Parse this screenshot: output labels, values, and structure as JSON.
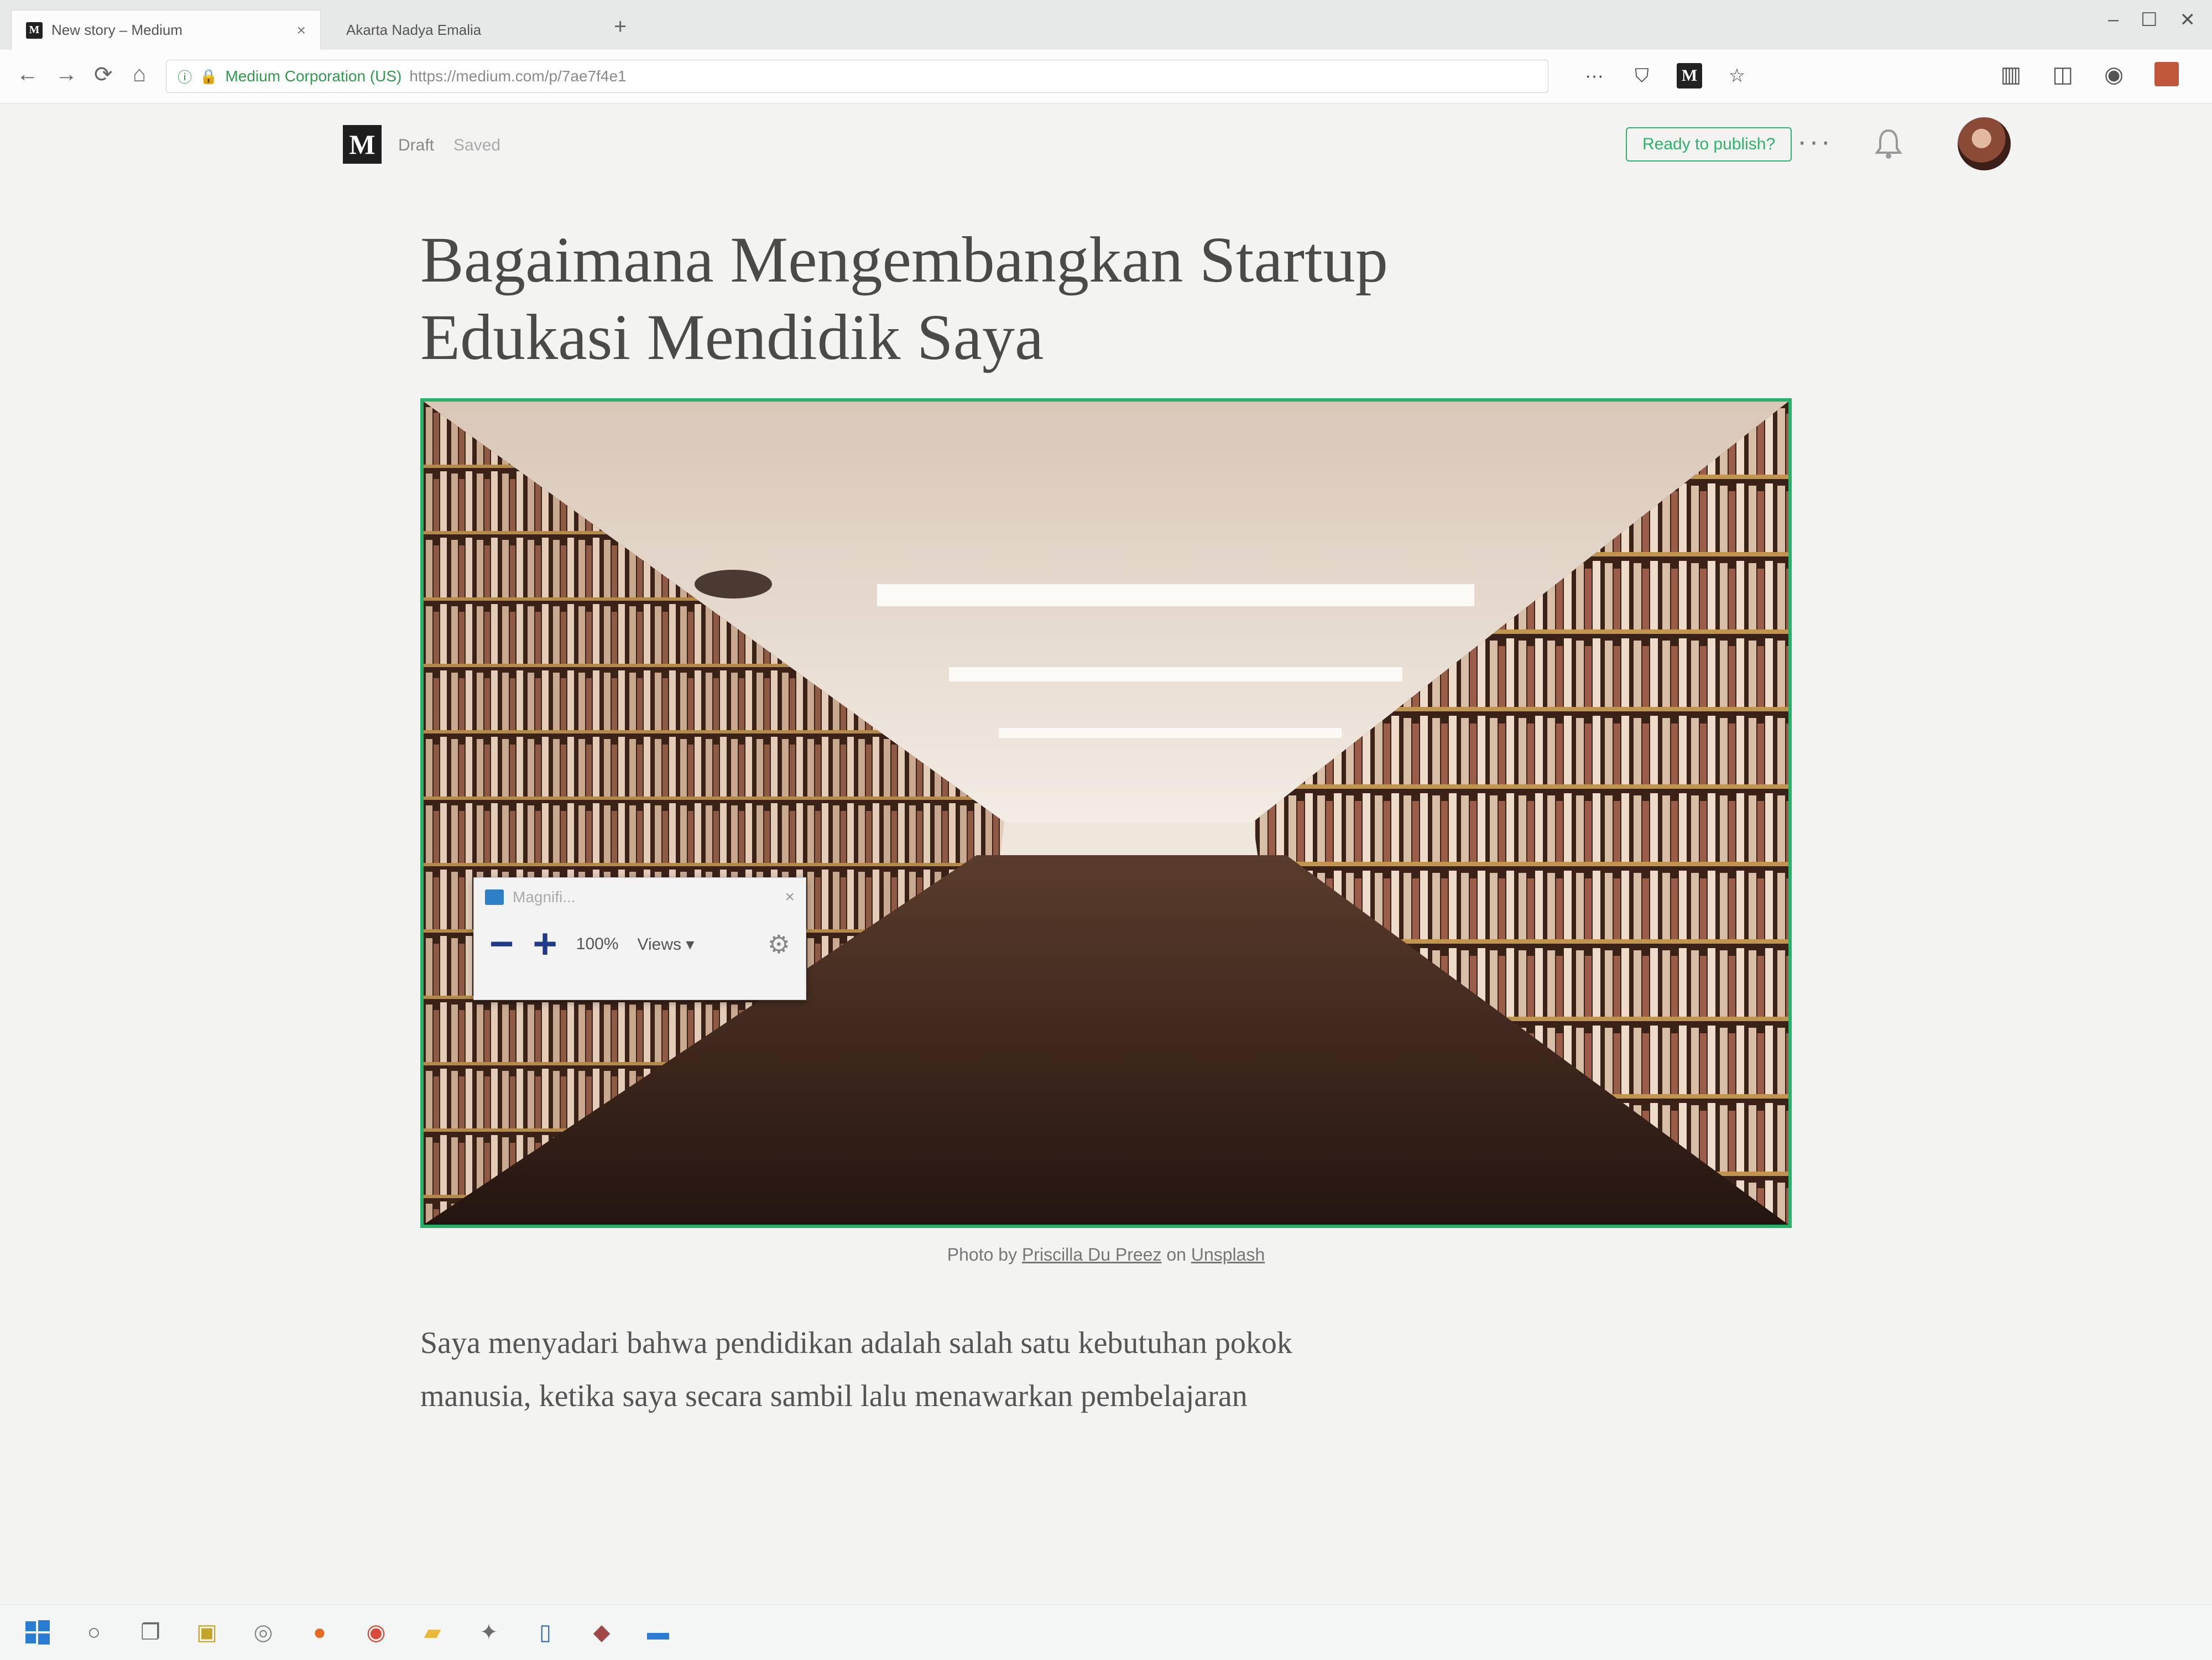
{
  "browser": {
    "tabs": [
      {
        "title": "New story – Medium",
        "favicon": "M",
        "active": true
      },
      {
        "title": "Akarta Nadya Emalia",
        "active": false
      }
    ],
    "url": {
      "secure_label": "Medium Corporation (US)",
      "address": "https://medium.com/p/7ae7f4e1"
    },
    "toolbar_icons": [
      "more-icon",
      "pocket-icon",
      "medium-icon",
      "star-icon"
    ],
    "right_icons": [
      "library-icon",
      "sidebar-icon",
      "account-icon",
      "extension-icon"
    ]
  },
  "editor": {
    "logo": "M",
    "status": "Draft",
    "saved": "Saved",
    "publish_label": "Ready to publish?",
    "more_label": "···"
  },
  "article": {
    "title_line1": "Bagaimana Mengembangkan Startup",
    "title_line2": "Edukasi Mendidik Saya",
    "caption_prefix": "Photo by",
    "caption_author": "Priscilla Du Preez",
    "caption_mid": "on",
    "caption_site": "Unsplash",
    "body_line1": "Saya menyadari bahwa pendidikan adalah salah satu kebutuhan pokok",
    "body_line2": "manusia, ketika saya secara sambil lalu menawarkan pembelajaran"
  },
  "magnifier": {
    "title": "Magnifi...",
    "zoom": "100%",
    "views": "Views ▾",
    "minus": "−",
    "plus": "+"
  },
  "taskbar": {
    "items": [
      "windows-icon",
      "search-icon",
      "task-view-icon",
      "store-icon",
      "app-icon",
      "firefox-icon",
      "chrome-icon",
      "explorer-icon",
      "tool-icon",
      "phone-icon",
      "network-icon",
      "laptop-icon"
    ]
  },
  "colors": {
    "accent": "#2bb36e",
    "magnifier_buttons": "#223a8a"
  }
}
